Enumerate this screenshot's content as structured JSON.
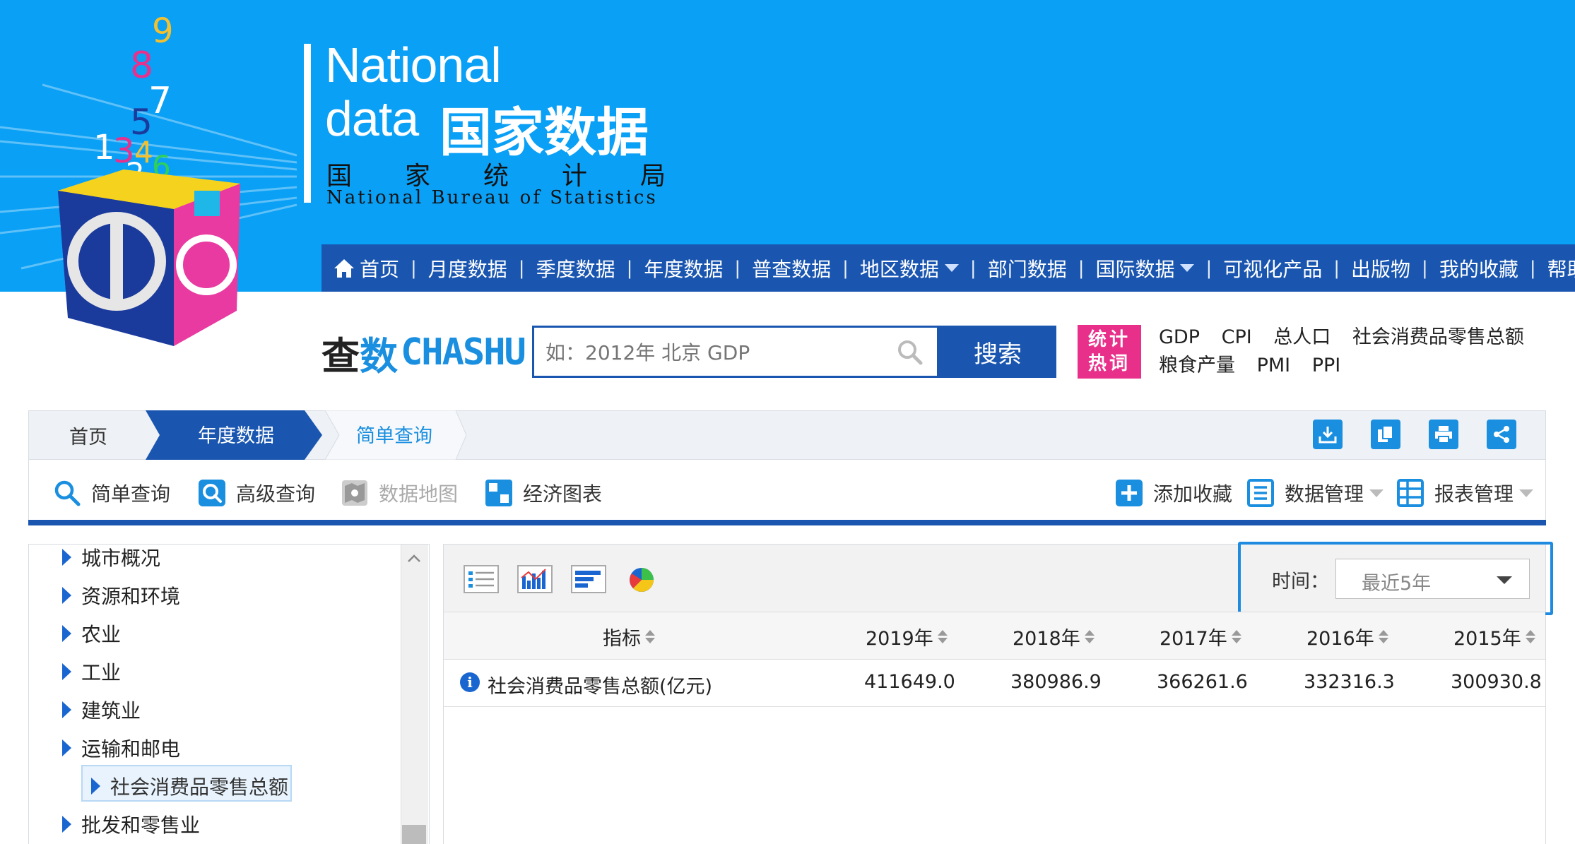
{
  "brand": {
    "line1": "National",
    "line2_en": "data",
    "line2_cn": "国家数据",
    "bureau_cn": [
      "国",
      "家",
      "统",
      "计",
      "局"
    ],
    "bureau_en": "National Bureau of Statistics",
    "logo_digits": [
      "9",
      "8",
      "7",
      "5",
      "1",
      "3",
      "4",
      "2",
      "6"
    ]
  },
  "nav": {
    "items": [
      {
        "label": "首页",
        "icon": "home-icon"
      },
      {
        "label": "月度数据"
      },
      {
        "label": "季度数据"
      },
      {
        "label": "年度数据"
      },
      {
        "label": "普查数据"
      },
      {
        "label": "地区数据",
        "dropdown": true
      },
      {
        "label": "部门数据"
      },
      {
        "label": "国际数据",
        "dropdown": true
      },
      {
        "label": "可视化产品"
      },
      {
        "label": "出版物"
      },
      {
        "label": "我的收藏"
      },
      {
        "label": "帮助"
      }
    ]
  },
  "search": {
    "logo_cn_1": "查",
    "logo_cn_2": "数",
    "logo_en": "CHASHU",
    "placeholder": "如：2012年 北京 GDP",
    "button": "搜索",
    "hot_badge_line1": "统计",
    "hot_badge_line2": "热词",
    "hot_words_row1": [
      "GDP",
      "CPI",
      "总人口",
      "社会消费品零售总额"
    ],
    "hot_words_row2": [
      "粮食产量",
      "PMI",
      "PPI"
    ]
  },
  "breadcrumb": {
    "home": "首页",
    "annual": "年度数据",
    "simple": "简单查询",
    "tools": [
      "download-icon",
      "copy-icon",
      "print-icon",
      "share-icon"
    ]
  },
  "toolbar": {
    "simple_query": "简单查询",
    "advanced_query": "高级查询",
    "data_map": "数据地图",
    "econ_chart": "经济图表",
    "add_favorite": "添加收藏",
    "data_manage": "数据管理",
    "report_manage": "报表管理"
  },
  "sidebar": {
    "items": [
      "城市概况",
      "资源和环境",
      "农业",
      "工业",
      "建筑业",
      "运输和邮电",
      "社会消费品零售总额",
      "批发和零售业"
    ],
    "selected": "社会消费品零售总额"
  },
  "main": {
    "view_icons": [
      "table-view-icon",
      "bar-chart-view-icon",
      "horizontal-bar-view-icon",
      "pie-chart-view-icon"
    ],
    "time_label": "时间：",
    "time_value": "最近5年",
    "header": {
      "indicator": "指标",
      "years": [
        "2019年",
        "2018年",
        "2017年",
        "2016年",
        "2015年"
      ]
    },
    "rows": [
      {
        "indicator": "社会消费品零售总额(亿元)",
        "values": [
          "411649.0",
          "380986.9",
          "366261.6",
          "332316.3",
          "300930.8"
        ]
      }
    ]
  },
  "colors": {
    "banner": "#0aa0f5",
    "nav": "#1a56b0",
    "accent": "#1a8fe0",
    "hot_badge": "#e8308a"
  }
}
